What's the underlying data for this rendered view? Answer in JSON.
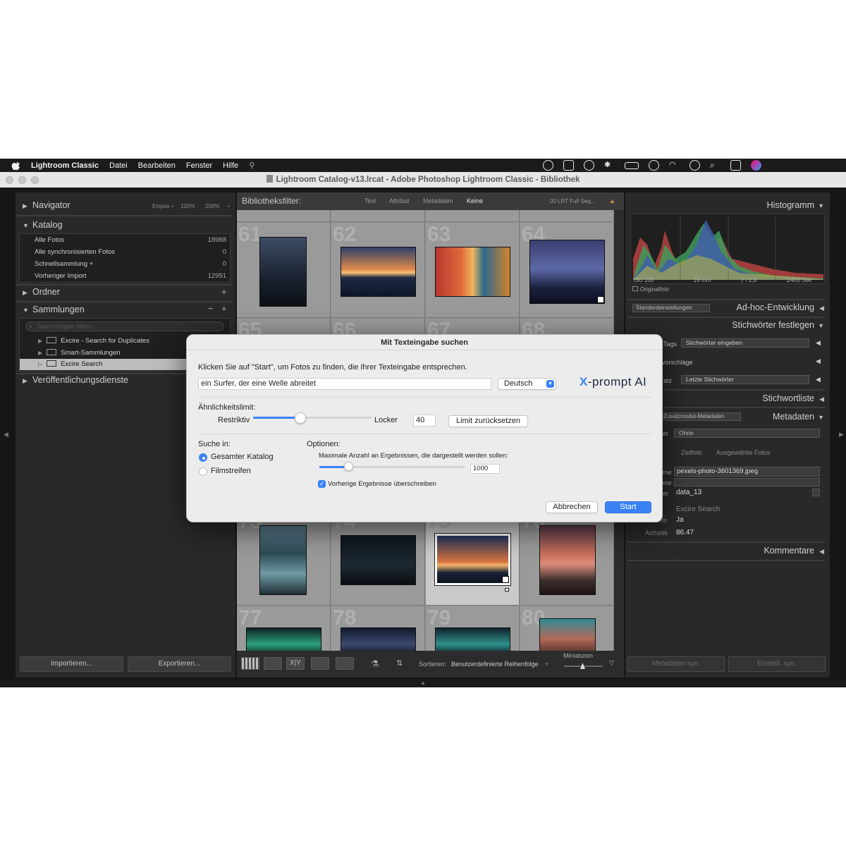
{
  "menubar": {
    "app_name": "Lightroom Classic",
    "items": [
      "Datei",
      "Bearbeiten",
      "Fenster",
      "Hilfe"
    ]
  },
  "window": {
    "title": "Lightroom Catalog-v13.lrcat - Adobe Photoshop Lightroom Classic - Bibliothek"
  },
  "left_panel": {
    "navigator": {
      "title": "Navigator",
      "zoom_fit": "Einpas ÷",
      "zoom_100": "100%",
      "zoom_200": "200%"
    },
    "catalog": {
      "title": "Katalog",
      "rows": [
        {
          "label": "Alle Fotos",
          "count": "18988"
        },
        {
          "label": "Alle synchronisierten Fotos",
          "count": "0"
        },
        {
          "label": "Schnellsammlung  +",
          "count": "0"
        },
        {
          "label": "Vorheriger Import",
          "count": "12991"
        }
      ]
    },
    "folders": {
      "title": "Ordner"
    },
    "collections": {
      "title": "Sammlungen",
      "filter_placeholder": "Sammlungen filtern",
      "items": [
        "Excire - Search for Duplicates",
        "Smart-Sammlungen",
        "Excire Search"
      ]
    },
    "publish": {
      "title": "Veröffentlichungsdienste"
    },
    "import_button": "Importieren...",
    "export_button": "Exportieren..."
  },
  "filter_bar": {
    "label": "Bibliotheksfilter:",
    "tabs": [
      "Text",
      "Attribut",
      "Metadaten",
      "Keine"
    ],
    "preset": "00 LRT Full Seq..."
  },
  "grid": {
    "row1": [
      "61",
      "62",
      "63",
      "64"
    ],
    "row2": [
      "65",
      "66",
      "67",
      "68"
    ],
    "row3": [
      "73",
      "74",
      "75",
      "76"
    ],
    "row4": [
      "77",
      "78",
      "79",
      "80"
    ]
  },
  "toolbar": {
    "sort_label": "Sortieren:",
    "sort_value": "Benutzerdefinierte Reihenfolge",
    "thumbs_label": "Miniaturen"
  },
  "right_panel": {
    "histogram": {
      "title": "Histogramm",
      "iso": "ISO 100",
      "focal": "28 mm",
      "aperture": "ƒ / 2,8",
      "shutter": "1/400 Sek.",
      "original": "Originalfoto"
    },
    "quick_develop": {
      "preset": "Standardeinstellungen",
      "title": "Ad-hoc-Entwicklung"
    },
    "keywording": {
      "title": "Stichwörter festlegen",
      "tags_label": "Tags",
      "tags_value": "Stichwörter eingeben",
      "suggestions": "vorschläge",
      "set_label": "atz",
      "set_value": "Letzte Stichwörter"
    },
    "keyword_list": {
      "title": "Stichwortliste"
    },
    "metadata": {
      "title": "Metadaten",
      "preset": "Zusatzmodul-Metadaten",
      "set_label": "et",
      "set_value": "Ohne",
      "target": "Zielfoto",
      "selected": "Ausgewählte Fotos",
      "filename_label": "me",
      "filename": "pexels-photo-3601369.jpeg",
      "copy_label": "me",
      "folder_label": "er",
      "folder": "data_13",
      "plugin": "Excire Search",
      "new_photo_label": "Neues Foto",
      "new_photo": "Ja",
      "aesthetic_label": "Ästhetik",
      "aesthetic": "86.47"
    },
    "comments": {
      "title": "Kommentare"
    },
    "sync_metadata": "Metadaten syn.",
    "sync_settings": "Einstell. syn."
  },
  "dialog": {
    "title": "Mit Texteingabe suchen",
    "instruction": "Klicken Sie auf \"Start\", um Fotos zu finden, die Ihrer Texteingabe entsprechen.",
    "query": "ein Surfer, der eine Welle abreitet",
    "language": "Deutsch",
    "brand_prefix": "X",
    "brand": "-prompt AI",
    "similarity_label": "Ähnlichkeitslimit:",
    "restrictive": "Restriktiv",
    "loose": "Locker",
    "similarity_value": "40",
    "similarity_fraction": 0.4,
    "reset_button": "Limit zurücksetzen",
    "search_in_label": "Suche in:",
    "search_options": [
      "Gesamter Katalog",
      "Filmstreifen"
    ],
    "options_label": "Optionen:",
    "max_results_label": "Maximale Anzahl an Ergebnissen, die dargestellt werden sollen:",
    "max_results_value": "1000",
    "max_results_fraction": 0.2,
    "overwrite_label": "Vorherige Ergebnisse überschreiben",
    "cancel_button": "Abbrechen",
    "start_button": "Start"
  },
  "colors": {
    "accent": "#3a82f6",
    "panel": "#292929",
    "grid_bg": "#8d8d8d"
  }
}
